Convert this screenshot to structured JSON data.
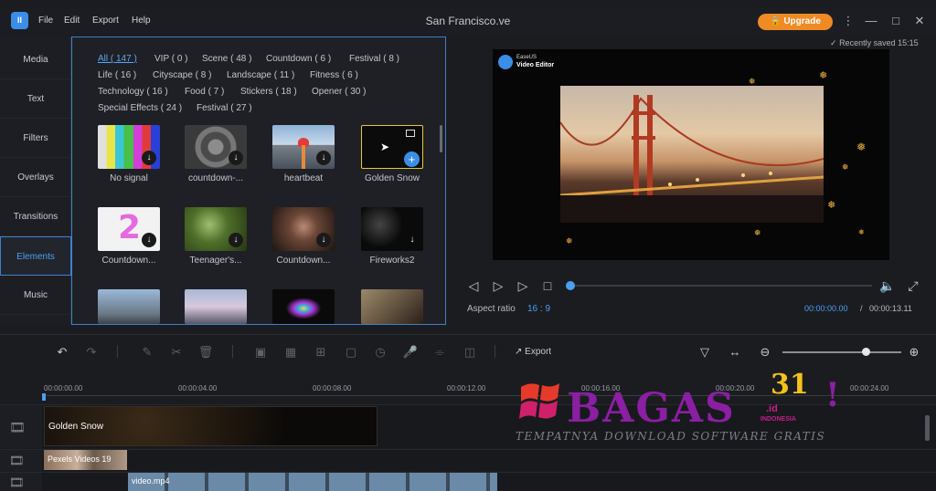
{
  "titlebar": {
    "logo_text": "II",
    "menu": [
      "File",
      "Edit",
      "Export",
      "Help"
    ],
    "title": "San Francisco.ve",
    "upgrade": "Upgrade",
    "upgrade_color": "#f08a24"
  },
  "left_tabs": [
    "Media",
    "Text",
    "Filters",
    "Overlays",
    "Transitions",
    "Elements",
    "Music"
  ],
  "active_tab": "Elements",
  "library": {
    "categories": [
      [
        "All ( 147 )",
        "VIP ( 0 )",
        "Scene ( 48 )",
        "Countdown ( 6 )",
        "Festival ( 8 )"
      ],
      [
        "Life ( 16 )",
        "Cityscape ( 8 )",
        "Landscape ( 11 )",
        "Fitness ( 6 )"
      ],
      [
        "Technology ( 16 )",
        "Food ( 7 )",
        "Stickers ( 18 )",
        "Opener ( 30 )"
      ],
      [
        "Special Effects ( 24 )",
        "Festival ( 27 )"
      ]
    ],
    "items": [
      {
        "label": "No signal"
      },
      {
        "label": "countdown-..."
      },
      {
        "label": "heartbeat"
      },
      {
        "label": "Golden Snow"
      },
      {
        "label": "Countdown..."
      },
      {
        "label": "Teenager's..."
      },
      {
        "label": "Countdown..."
      },
      {
        "label": "Fireworks2"
      },
      {
        "label": ""
      },
      {
        "label": ""
      },
      {
        "label": ""
      },
      {
        "label": ""
      }
    ]
  },
  "preview": {
    "saved": "Recently saved 15:15",
    "brand_line1": "EaseUS",
    "brand_line2": "Video Editor",
    "aspect_label": "Aspect ratio",
    "aspect_value": "16 : 9",
    "time_current": "00:00:00.00",
    "time_sep": "/",
    "time_total": "00:00:13.11",
    "progress": 0.0,
    "accent": "#4a9ff5"
  },
  "toolbar": {
    "export_label": "Export",
    "zoom_level": 0.7
  },
  "timeline": {
    "ticks": [
      "00:00:00.00",
      "00:00:04.00",
      "00:00:08.00",
      "00:00:12.00",
      "00:00:16.00",
      "00:00:20.00",
      "00:00:24.00"
    ],
    "clips": {
      "overlay": "Golden Snow",
      "pip": "Pexels Videos 19",
      "main": "video.mp4"
    }
  },
  "watermark": {
    "text": "BAGAS",
    "number": "31",
    "domain": ".id",
    "country": "INDONESIA",
    "tagline": "TEMPATNYA DOWNLOAD SOFTWARE GRATIS"
  }
}
